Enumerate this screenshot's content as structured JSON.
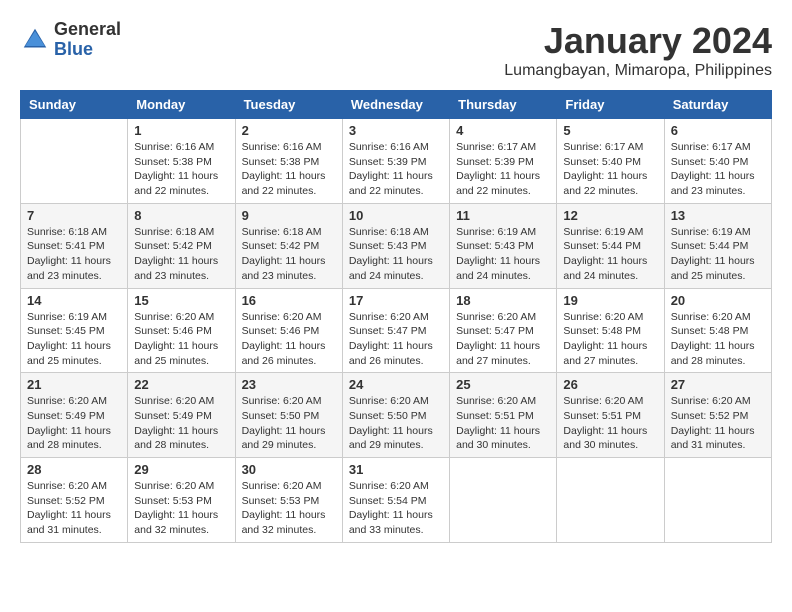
{
  "logo": {
    "general": "General",
    "blue": "Blue"
  },
  "title": {
    "month_year": "January 2024",
    "location": "Lumangbayan, Mimaropa, Philippines"
  },
  "headers": [
    "Sunday",
    "Monday",
    "Tuesday",
    "Wednesday",
    "Thursday",
    "Friday",
    "Saturday"
  ],
  "weeks": [
    [
      {
        "day": "",
        "info": ""
      },
      {
        "day": "1",
        "info": "Sunrise: 6:16 AM\nSunset: 5:38 PM\nDaylight: 11 hours and 22 minutes."
      },
      {
        "day": "2",
        "info": "Sunrise: 6:16 AM\nSunset: 5:38 PM\nDaylight: 11 hours and 22 minutes."
      },
      {
        "day": "3",
        "info": "Sunrise: 6:16 AM\nSunset: 5:39 PM\nDaylight: 11 hours and 22 minutes."
      },
      {
        "day": "4",
        "info": "Sunrise: 6:17 AM\nSunset: 5:39 PM\nDaylight: 11 hours and 22 minutes."
      },
      {
        "day": "5",
        "info": "Sunrise: 6:17 AM\nSunset: 5:40 PM\nDaylight: 11 hours and 22 minutes."
      },
      {
        "day": "6",
        "info": "Sunrise: 6:17 AM\nSunset: 5:40 PM\nDaylight: 11 hours and 23 minutes."
      }
    ],
    [
      {
        "day": "7",
        "info": "Sunrise: 6:18 AM\nSunset: 5:41 PM\nDaylight: 11 hours and 23 minutes."
      },
      {
        "day": "8",
        "info": "Sunrise: 6:18 AM\nSunset: 5:42 PM\nDaylight: 11 hours and 23 minutes."
      },
      {
        "day": "9",
        "info": "Sunrise: 6:18 AM\nSunset: 5:42 PM\nDaylight: 11 hours and 23 minutes."
      },
      {
        "day": "10",
        "info": "Sunrise: 6:18 AM\nSunset: 5:43 PM\nDaylight: 11 hours and 24 minutes."
      },
      {
        "day": "11",
        "info": "Sunrise: 6:19 AM\nSunset: 5:43 PM\nDaylight: 11 hours and 24 minutes."
      },
      {
        "day": "12",
        "info": "Sunrise: 6:19 AM\nSunset: 5:44 PM\nDaylight: 11 hours and 24 minutes."
      },
      {
        "day": "13",
        "info": "Sunrise: 6:19 AM\nSunset: 5:44 PM\nDaylight: 11 hours and 25 minutes."
      }
    ],
    [
      {
        "day": "14",
        "info": "Sunrise: 6:19 AM\nSunset: 5:45 PM\nDaylight: 11 hours and 25 minutes."
      },
      {
        "day": "15",
        "info": "Sunrise: 6:20 AM\nSunset: 5:46 PM\nDaylight: 11 hours and 25 minutes."
      },
      {
        "day": "16",
        "info": "Sunrise: 6:20 AM\nSunset: 5:46 PM\nDaylight: 11 hours and 26 minutes."
      },
      {
        "day": "17",
        "info": "Sunrise: 6:20 AM\nSunset: 5:47 PM\nDaylight: 11 hours and 26 minutes."
      },
      {
        "day": "18",
        "info": "Sunrise: 6:20 AM\nSunset: 5:47 PM\nDaylight: 11 hours and 27 minutes."
      },
      {
        "day": "19",
        "info": "Sunrise: 6:20 AM\nSunset: 5:48 PM\nDaylight: 11 hours and 27 minutes."
      },
      {
        "day": "20",
        "info": "Sunrise: 6:20 AM\nSunset: 5:48 PM\nDaylight: 11 hours and 28 minutes."
      }
    ],
    [
      {
        "day": "21",
        "info": "Sunrise: 6:20 AM\nSunset: 5:49 PM\nDaylight: 11 hours and 28 minutes."
      },
      {
        "day": "22",
        "info": "Sunrise: 6:20 AM\nSunset: 5:49 PM\nDaylight: 11 hours and 28 minutes."
      },
      {
        "day": "23",
        "info": "Sunrise: 6:20 AM\nSunset: 5:50 PM\nDaylight: 11 hours and 29 minutes."
      },
      {
        "day": "24",
        "info": "Sunrise: 6:20 AM\nSunset: 5:50 PM\nDaylight: 11 hours and 29 minutes."
      },
      {
        "day": "25",
        "info": "Sunrise: 6:20 AM\nSunset: 5:51 PM\nDaylight: 11 hours and 30 minutes."
      },
      {
        "day": "26",
        "info": "Sunrise: 6:20 AM\nSunset: 5:51 PM\nDaylight: 11 hours and 30 minutes."
      },
      {
        "day": "27",
        "info": "Sunrise: 6:20 AM\nSunset: 5:52 PM\nDaylight: 11 hours and 31 minutes."
      }
    ],
    [
      {
        "day": "28",
        "info": "Sunrise: 6:20 AM\nSunset: 5:52 PM\nDaylight: 11 hours and 31 minutes."
      },
      {
        "day": "29",
        "info": "Sunrise: 6:20 AM\nSunset: 5:53 PM\nDaylight: 11 hours and 32 minutes."
      },
      {
        "day": "30",
        "info": "Sunrise: 6:20 AM\nSunset: 5:53 PM\nDaylight: 11 hours and 32 minutes."
      },
      {
        "day": "31",
        "info": "Sunrise: 6:20 AM\nSunset: 5:54 PM\nDaylight: 11 hours and 33 minutes."
      },
      {
        "day": "",
        "info": ""
      },
      {
        "day": "",
        "info": ""
      },
      {
        "day": "",
        "info": ""
      }
    ]
  ]
}
